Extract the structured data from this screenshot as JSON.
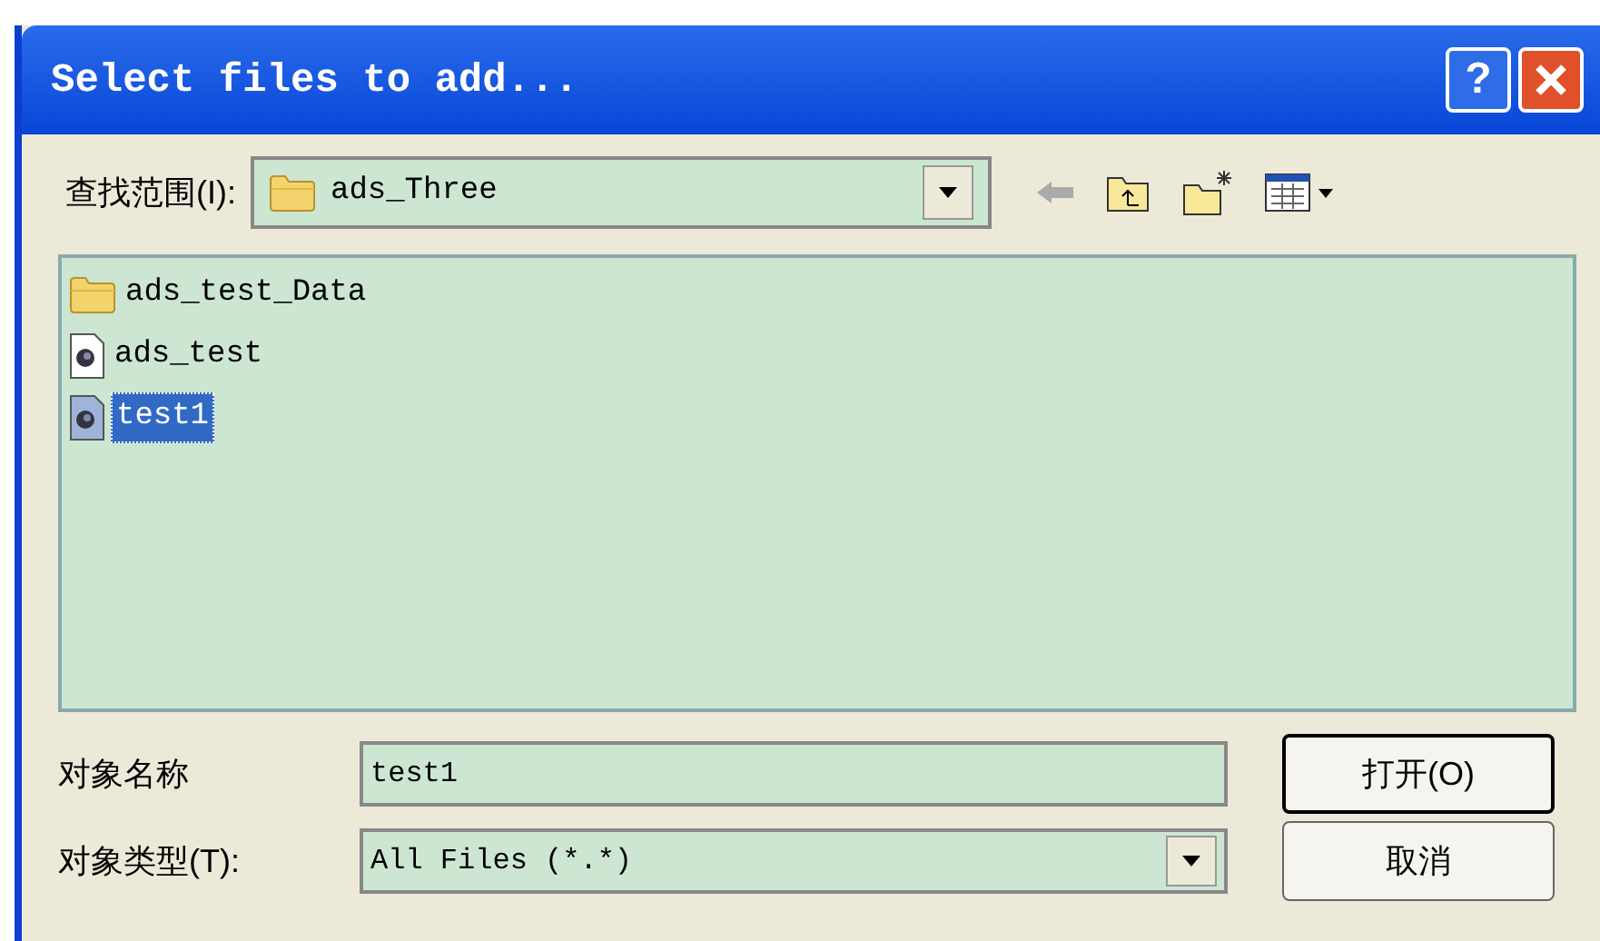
{
  "window": {
    "title": "Select files to add..."
  },
  "title_buttons": [
    "?"
  ],
  "look_in": {
    "label": "查找范围(I):",
    "value": "ads_Three"
  },
  "files": [
    {
      "name": "ads_test_Data",
      "kind": "folder",
      "selected": false
    },
    {
      "name": "ads_test",
      "kind": "file",
      "selected": false
    },
    {
      "name": "test1",
      "kind": "file",
      "selected": true
    }
  ],
  "object_name": {
    "label": "对象名称",
    "value": "test1"
  },
  "object_type": {
    "label": "对象类型(T):",
    "value": "All Files (*.*)"
  },
  "buttons": [
    "打开(O)",
    "取消"
  ]
}
